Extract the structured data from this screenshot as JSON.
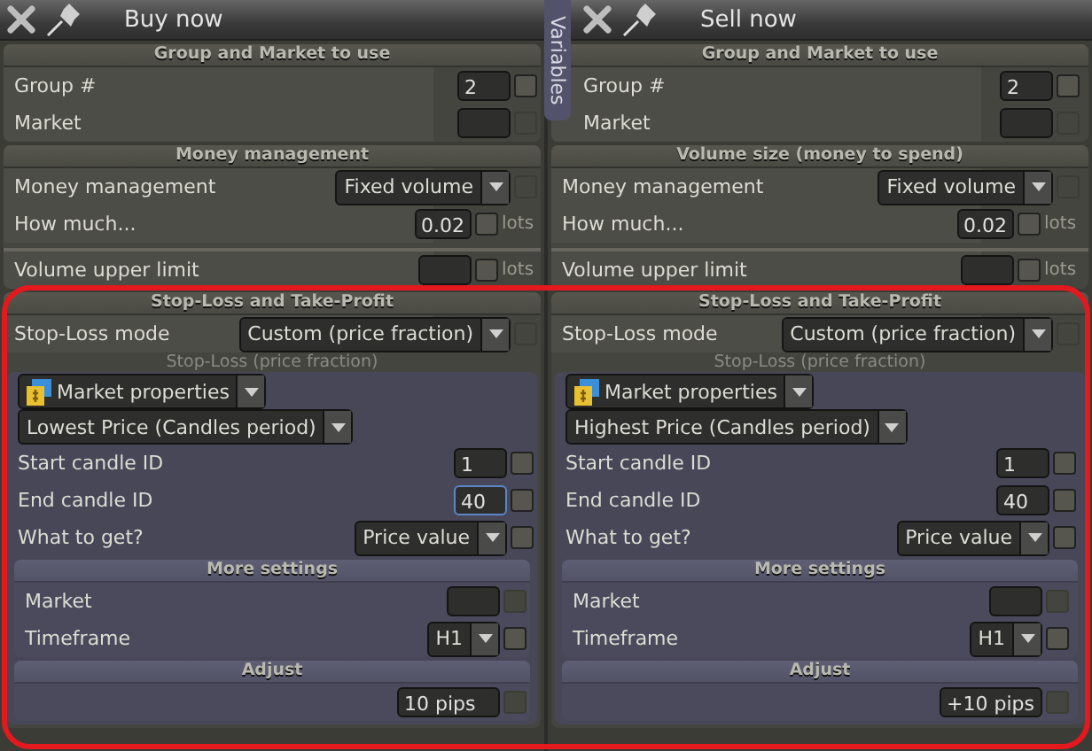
{
  "side_tab": {
    "label": "Variables"
  },
  "panels": [
    {
      "title": "Buy now",
      "closable": true,
      "sections": [
        {
          "title": "Group and Market to use",
          "rows": [
            {
              "kind": "input",
              "label": "Group #",
              "value": "2",
              "check": {
                "checked": false,
                "disabled": false
              }
            },
            {
              "kind": "input",
              "label": "Market",
              "value": "",
              "check": {
                "checked": false,
                "disabled": true
              }
            }
          ]
        },
        {
          "title": "Money management",
          "rows": [
            {
              "kind": "select",
              "label": "Money management",
              "value": "Fixed volume",
              "check": {
                "checked": false,
                "disabled": true
              }
            },
            {
              "kind": "input",
              "label": "How much...",
              "value": "0.02",
              "unit": "lots",
              "check": {
                "checked": false,
                "disabled": false
              }
            },
            {
              "kind": "input",
              "label": "Volume upper limit",
              "value": "",
              "unit": "lots",
              "separated": true,
              "check": {
                "checked": false,
                "disabled": false
              }
            }
          ]
        },
        {
          "title": "Stop-Loss and Take-Profit",
          "rows": [
            {
              "kind": "select",
              "label": "Stop-Loss mode",
              "value": "Custom (price fraction)",
              "check": {
                "checked": false,
                "disabled": true
              }
            },
            {
              "kind": "subtitle",
              "label": "Stop-Loss (price fraction)"
            },
            {
              "kind": "panel",
              "items": [
                {
                  "kind": "picker",
                  "icon": true,
                  "value": "Market properties"
                },
                {
                  "kind": "picker",
                  "value": "Lowest Price (Candles period)"
                },
                {
                  "kind": "input",
                  "label": "Start candle ID",
                  "value": "1",
                  "check": {
                    "checked": false,
                    "disabled": false
                  }
                },
                {
                  "kind": "input",
                  "label": "End candle ID",
                  "value": "40",
                  "focused": true,
                  "check": {
                    "checked": false,
                    "disabled": false
                  }
                },
                {
                  "kind": "select",
                  "label": "What to get?",
                  "value": "Price value",
                  "check": {
                    "checked": false,
                    "disabled": false
                  }
                },
                {
                  "kind": "subsection",
                  "title": "More settings",
                  "rows": [
                    {
                      "kind": "input",
                      "label": "Market",
                      "value": "",
                      "check": {
                        "checked": false,
                        "disabled": true
                      }
                    },
                    {
                      "kind": "select",
                      "label": "Timeframe",
                      "value": "H1",
                      "check": {
                        "checked": false,
                        "disabled": false
                      }
                    }
                  ]
                },
                {
                  "kind": "subsection",
                  "title": "Adjust",
                  "rows": [
                    {
                      "kind": "input",
                      "value": "10 pips",
                      "wide": true,
                      "check": {
                        "checked": false,
                        "disabled": true
                      }
                    }
                  ]
                }
              ]
            }
          ]
        }
      ]
    },
    {
      "title": "Sell now",
      "closable": true,
      "sections": [
        {
          "title": "Group and Market to use",
          "rows": [
            {
              "kind": "input",
              "label": "Group #",
              "value": "2",
              "check": {
                "checked": false,
                "disabled": false
              }
            },
            {
              "kind": "input",
              "label": "Market",
              "value": "",
              "check": {
                "checked": false,
                "disabled": true
              }
            }
          ]
        },
        {
          "title": "Volume size (money to spend)",
          "rows": [
            {
              "kind": "select",
              "label": "Money management",
              "value": "Fixed volume",
              "check": {
                "checked": false,
                "disabled": true
              }
            },
            {
              "kind": "input",
              "label": "How much...",
              "value": "0.02",
              "unit": "lots",
              "check": {
                "checked": false,
                "disabled": false
              }
            },
            {
              "kind": "input",
              "label": "Volume upper limit",
              "value": "",
              "unit": "lots",
              "separated": true,
              "check": {
                "checked": false,
                "disabled": false
              }
            }
          ]
        },
        {
          "title": "Stop-Loss and Take-Profit",
          "rows": [
            {
              "kind": "select",
              "label": "Stop-Loss mode",
              "value": "Custom (price fraction)",
              "check": {
                "checked": false,
                "disabled": true
              }
            },
            {
              "kind": "subtitle",
              "label": "Stop-Loss (price fraction)"
            },
            {
              "kind": "panel",
              "items": [
                {
                  "kind": "picker",
                  "icon": true,
                  "value": "Market properties"
                },
                {
                  "kind": "picker",
                  "value": "Highest Price (Candles period)"
                },
                {
                  "kind": "input",
                  "label": "Start candle ID",
                  "value": "1",
                  "check": {
                    "checked": false,
                    "disabled": false
                  }
                },
                {
                  "kind": "input",
                  "label": "End candle ID",
                  "value": "40",
                  "focused": false,
                  "check": {
                    "checked": false,
                    "disabled": false
                  }
                },
                {
                  "kind": "select",
                  "label": "What to get?",
                  "value": "Price value",
                  "check": {
                    "checked": false,
                    "disabled": false
                  }
                },
                {
                  "kind": "subsection",
                  "title": "More settings",
                  "rows": [
                    {
                      "kind": "input",
                      "label": "Market",
                      "value": "",
                      "check": {
                        "checked": false,
                        "disabled": true
                      }
                    },
                    {
                      "kind": "select",
                      "label": "Timeframe",
                      "value": "H1",
                      "check": {
                        "checked": false,
                        "disabled": false
                      }
                    }
                  ]
                },
                {
                  "kind": "subsection",
                  "title": "Adjust",
                  "rows": [
                    {
                      "kind": "input",
                      "value": "+10 pips",
                      "wide": true,
                      "check": {
                        "checked": false,
                        "disabled": true
                      }
                    }
                  ]
                }
              ]
            }
          ]
        }
      ]
    }
  ],
  "annotation": {
    "kind": "highlight",
    "color": "#e3191e"
  }
}
